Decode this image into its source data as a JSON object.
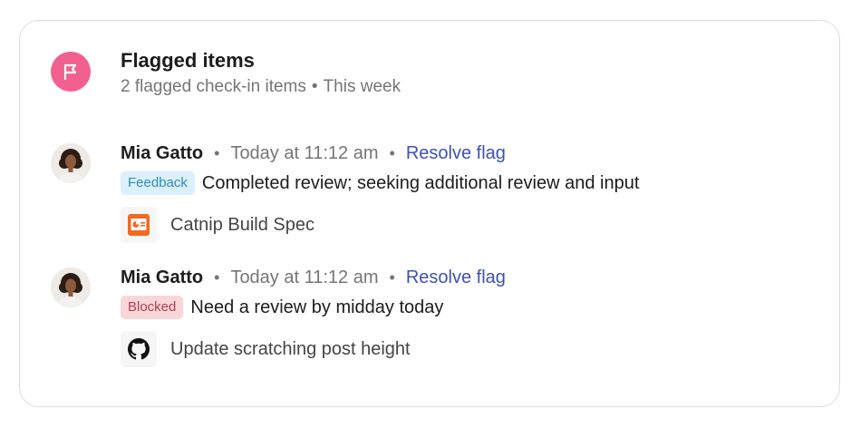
{
  "header": {
    "icon": "flag-icon",
    "accent_color": "#f2608f",
    "title": "Flagged items",
    "subtitle_count": "2 flagged check-in items",
    "subtitle_separator": "•",
    "subtitle_period": "This week"
  },
  "items": [
    {
      "author": "Mia Gatto",
      "separator": "•",
      "time": "Today at 11:12 am",
      "action": "Resolve flag",
      "tag": "Feedback",
      "message": "Completed review; seeking additional review and input",
      "attachment": {
        "icon": "presentation-icon",
        "title": "Catnip Build Spec"
      }
    },
    {
      "author": "Mia Gatto",
      "separator": "•",
      "time": "Today at 11:12 am",
      "action": "Resolve flag",
      "tag": "Blocked",
      "message": "Need a review by midday today",
      "attachment": {
        "icon": "github-icon",
        "title": "Update scratching post height"
      }
    }
  ]
}
